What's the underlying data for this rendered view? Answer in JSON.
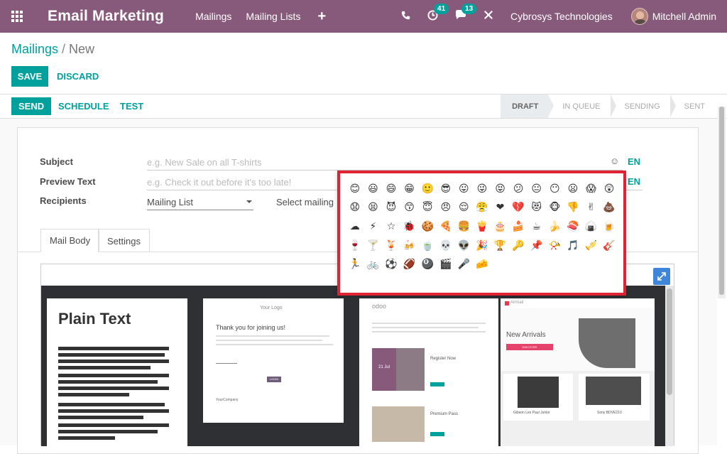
{
  "navbar": {
    "app_title": "Email Marketing",
    "menu": [
      "Mailings",
      "Mailing Lists"
    ],
    "plus": "+",
    "activity_badge": "41",
    "message_badge": "13",
    "company": "Cybrosys Technologies",
    "user": "Mitchell Admin"
  },
  "breadcrumb": {
    "parent": "Mailings",
    "separator": "/",
    "current": "New"
  },
  "buttons": {
    "save": "SAVE",
    "discard": "DISCARD"
  },
  "statusbar": {
    "actions": [
      "SEND",
      "SCHEDULE",
      "TEST"
    ],
    "stages": [
      "DRAFT",
      "IN QUEUE",
      "SENDING",
      "SENT"
    ],
    "active_stage": "DRAFT"
  },
  "form": {
    "subject_label": "Subject",
    "subject_placeholder": "e.g. New Sale on all T-shirts",
    "preview_label": "Preview Text",
    "preview_placeholder": "e.g. Check it out before it's too late!",
    "recipients_label": "Recipients",
    "recipients_value": "Mailing List",
    "select_mailing": "Select mailing",
    "lang": "EN",
    "emoji_trigger": "☺"
  },
  "tabs": [
    "Mail Body",
    "Settings"
  ],
  "templates": {
    "plain_title": "Plain Text",
    "welcome_logo": "Your Logo",
    "welcome_heading": "Thank you for joining us!",
    "welcome_button": "LOGIN",
    "welcome_footer_company": "YourCompany",
    "odoo_logo": "odoo",
    "odoo_date": "21 Jul",
    "odoo_card1": "Register Now",
    "odoo_card2": "Premium Pass",
    "airmail_logo": "Airmail",
    "airmail_heading": "New Arrivals",
    "airmail_button": "DISCOVER",
    "airmail_prod1": "Gibson Les Paul Junior",
    "airmail_prod2": "Sony BDVE210"
  },
  "emojis": [
    "😊",
    "😃",
    "😄",
    "😁",
    "🙂",
    "😎",
    "😛",
    "😜",
    "😝",
    "😕",
    "😐",
    "😶",
    "😦",
    "😱",
    "😲",
    "😧",
    "😫",
    "😈",
    "😙",
    "😇",
    "😠",
    "😌",
    "😤",
    "❤",
    "💔",
    "😻",
    "🐵",
    "👎",
    "✌",
    "💩",
    "☁",
    "⚡",
    "☆",
    "🐞",
    "🍪",
    "🍕",
    "🍔",
    "🍟",
    "🎂",
    "🍰",
    "☕",
    "🍌",
    "🍣",
    "🍙",
    "🍺",
    "🍷",
    "🍸",
    "🍹",
    "🍻",
    "🍵",
    "💀",
    "👽",
    "🎉",
    "🏆",
    "🔑",
    "📌",
    "📯",
    "🎵",
    "🎺",
    "🎸",
    "🏃",
    "🚲",
    "⚽",
    "🏈",
    "🎱",
    "🎬",
    "🎤",
    "🧀"
  ]
}
